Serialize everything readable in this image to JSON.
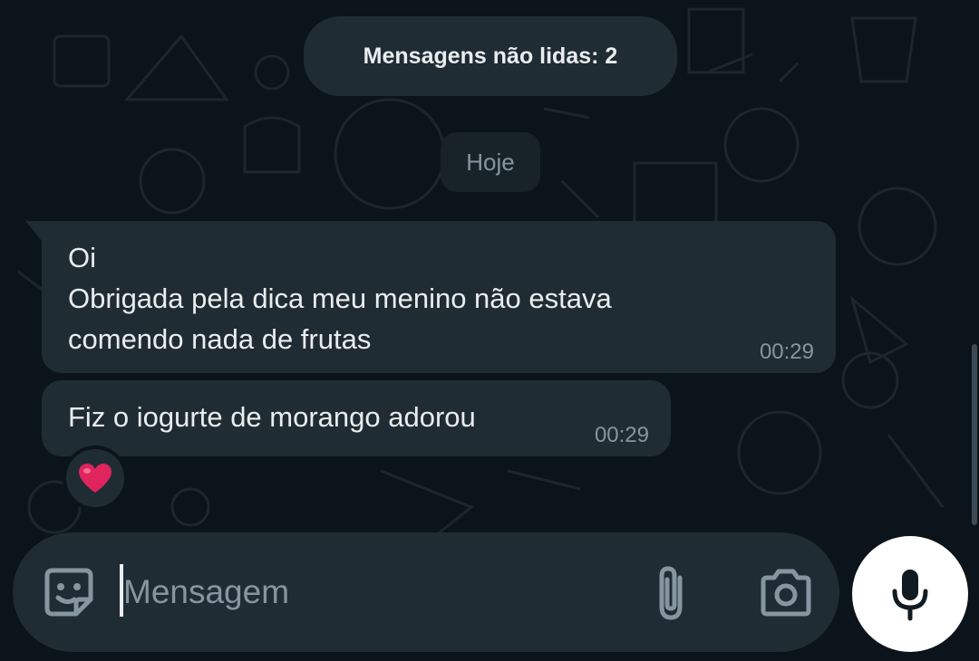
{
  "banner": {
    "unread_label": "Mensagens não lidas: 2"
  },
  "date_divider": {
    "label": "Hoje"
  },
  "messages": [
    {
      "lines": [
        "Oi",
        "Obrigada pela dica meu menino não estava",
        "comendo nada de frutas"
      ],
      "time": "00:29"
    },
    {
      "lines": [
        "Fiz o iogurte de morango adorou"
      ],
      "time": "00:29",
      "reaction": "❤️"
    }
  ],
  "composer": {
    "placeholder": "Mensagem",
    "value": ""
  },
  "icons": {
    "sticker": "sticker-smiley-icon",
    "attach": "paperclip-icon",
    "camera": "camera-icon",
    "mic": "microphone-icon"
  },
  "colors": {
    "background": "#0b141a",
    "bubble": "#202c33",
    "text": "#e9edef",
    "muted": "#8696a0",
    "heart": "#e0245e"
  }
}
